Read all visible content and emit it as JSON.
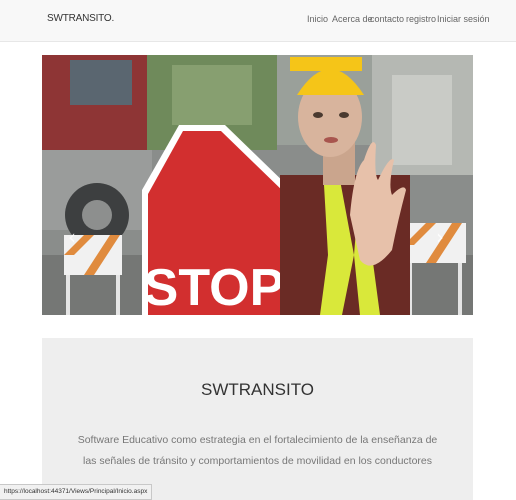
{
  "navbar": {
    "brand": "SWTRANSITO.",
    "links": [
      "Inicio",
      "Acerca de",
      "contacto",
      "registro",
      "Iniciar sesión"
    ]
  },
  "carousel": {
    "image": "stop-sign-photo",
    "sign_text": "STOP",
    "prev_icon": "chevron-left-icon",
    "next_icon": "chevron-right-icon",
    "indicator_count": 3,
    "active_indicator": 0,
    "colors": {
      "sign": "#d22f2f",
      "vest": "#d9e83a",
      "helmet": "#f5c518"
    }
  },
  "jumbotron": {
    "title": "SWTRANSITO",
    "description": "Software Educativo como estrategia en el fortalecimiento de la enseñanza de las señales de tránsito y comportamientos de movilidad en los conductores"
  },
  "statusbar": {
    "url": "https://localhost:44371/Views/Principal/Inicio.aspx"
  }
}
